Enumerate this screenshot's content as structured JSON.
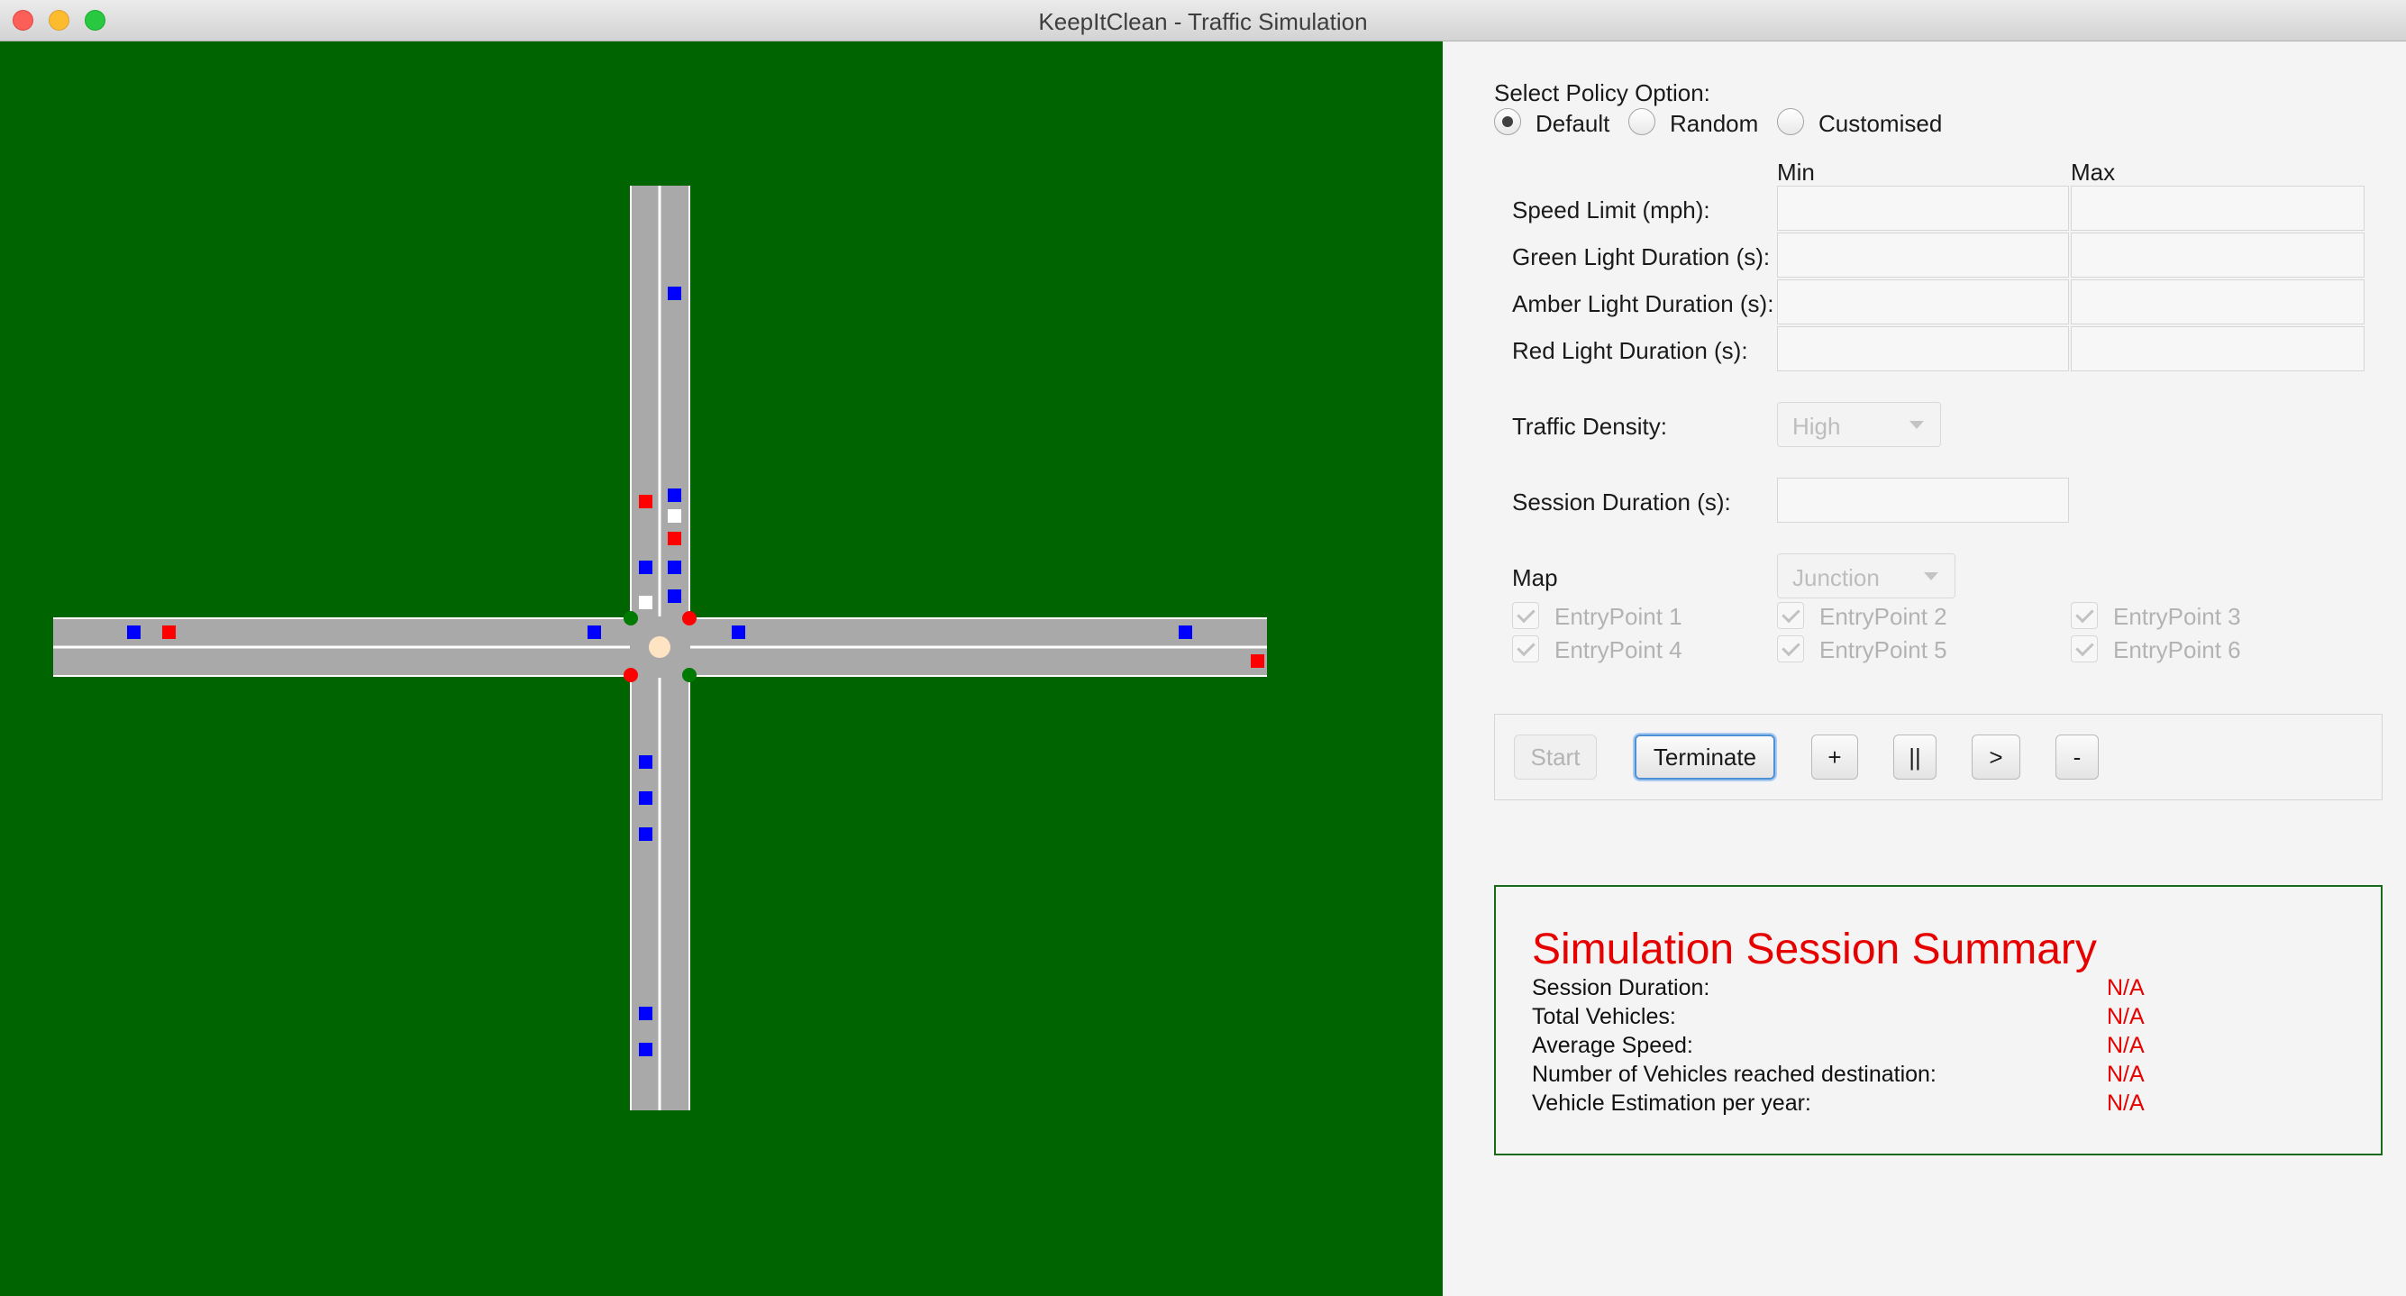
{
  "window": {
    "title": "KeepItClean - Traffic Simulation"
  },
  "policy": {
    "label": "Select Policy Option:",
    "options": [
      {
        "label": "Default",
        "selected": true
      },
      {
        "label": "Random",
        "selected": false
      },
      {
        "label": "Customised",
        "selected": false
      }
    ]
  },
  "ranges": {
    "min_header": "Min",
    "max_header": "Max",
    "rows": [
      {
        "label": "Speed Limit (mph):",
        "min": "",
        "max": ""
      },
      {
        "label": "Green Light Duration (s):",
        "min": "",
        "max": ""
      },
      {
        "label": "Amber Light Duration (s):",
        "min": "",
        "max": ""
      },
      {
        "label": "Red Light Duration (s):",
        "min": "",
        "max": ""
      }
    ]
  },
  "density": {
    "label": "Traffic Density:",
    "value": "High"
  },
  "session": {
    "label": "Session Duration (s):",
    "value": ""
  },
  "map": {
    "label": "Map",
    "value": "Junction",
    "entry_points": [
      {
        "label": "EntryPoint 1",
        "checked": true
      },
      {
        "label": "EntryPoint 2",
        "checked": true
      },
      {
        "label": "EntryPoint 3",
        "checked": true
      },
      {
        "label": "EntryPoint 4",
        "checked": true
      },
      {
        "label": "EntryPoint 5",
        "checked": true
      },
      {
        "label": "EntryPoint 6",
        "checked": true
      }
    ]
  },
  "controls": {
    "start": "Start",
    "terminate": "Terminate",
    "plus": "+",
    "pause": "||",
    "play": ">",
    "minus": "-"
  },
  "summary": {
    "title": "Simulation Session Summary",
    "rows": [
      {
        "label": "Session Duration:",
        "value": "N/A"
      },
      {
        "label": "Total Vehicles:",
        "value": "N/A"
      },
      {
        "label": "Average Speed:",
        "value": "N/A"
      },
      {
        "label": "Number of Vehicles reached destination:",
        "value": "N/A"
      },
      {
        "label": "Vehicle Estimation per year:",
        "value": "N/A"
      }
    ]
  },
  "colors": {
    "grass": "#006400",
    "road": "#a9a9a9",
    "lane_line": "#ffffff",
    "vehicle_blue": "#0000ff",
    "vehicle_red": "#ff0000",
    "vehicle_white": "#ffffff",
    "light_green": "#007a00",
    "light_red": "#ff0000",
    "summary_accent": "#e60000"
  }
}
